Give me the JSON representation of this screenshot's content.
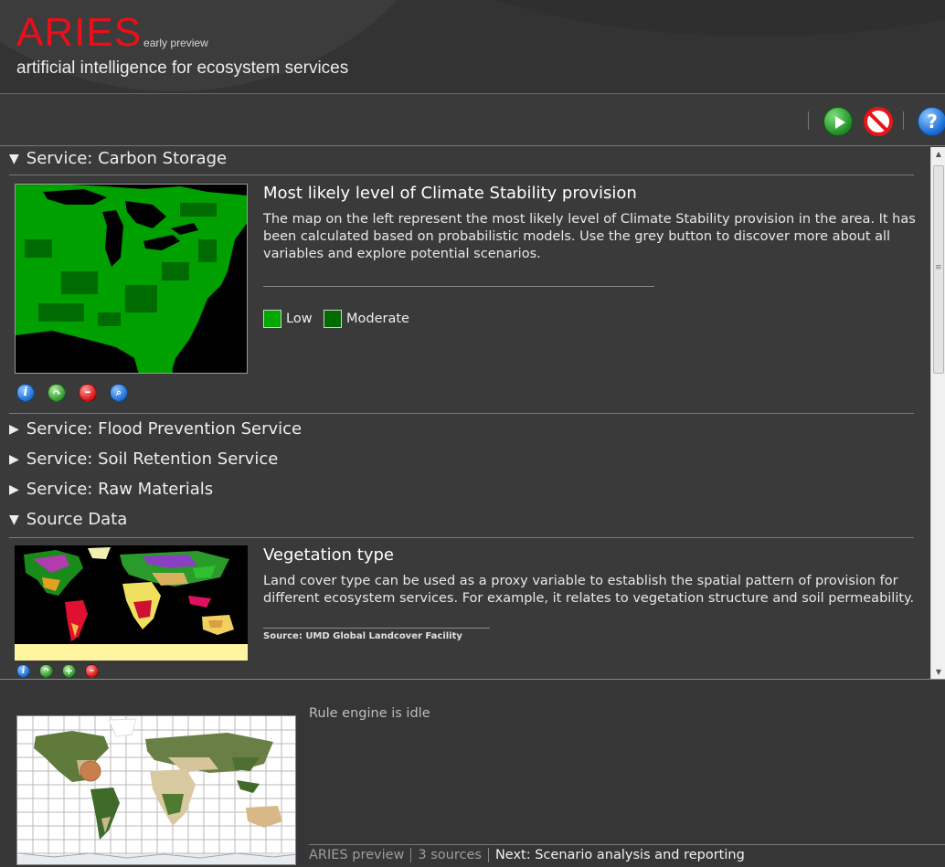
{
  "header": {
    "brand": "ARIES",
    "brand_sub": "early preview",
    "tagline": "artificial intelligence for ecosystem services"
  },
  "toolbar": {
    "run_icon": "play-icon",
    "stop_icon": "stop-icon",
    "help_icon": "help-icon",
    "help_glyph": "?"
  },
  "sections": {
    "carbon": {
      "label": "Service: Carbon Storage",
      "expanded": true
    },
    "flood": {
      "label": "Service: Flood Prevention Service",
      "expanded": false
    },
    "soil": {
      "label": "Service: Soil Retention Service",
      "expanded": false
    },
    "raw": {
      "label": "Service: Raw Materials",
      "expanded": false
    },
    "source": {
      "label": "Source Data",
      "expanded": true
    }
  },
  "carbon_card": {
    "title": "Most likely level of Climate Stability provision",
    "description": "The map on the left represent the most likely level of Climate Stability provision in the area. It has been calculated based on probabilistic models. Use the grey button to discover more about all variables and explore potential scenarios.",
    "legend": [
      {
        "label": "Low",
        "color": "#00a800"
      },
      {
        "label": "Moderate",
        "color": "#006b00"
      }
    ],
    "actions": [
      "info-icon",
      "share-icon",
      "remove-icon",
      "zoom-icon"
    ]
  },
  "vegetation_card": {
    "title": "Vegetation type",
    "description": "Land cover type can be used as a proxy variable to establish the spatial pattern of provision for different ecosystem services. For example, it relates to vegetation structure and soil permeability.",
    "source": "Source: UMD Global Landcover Facility",
    "actions": [
      "info-icon",
      "share-icon",
      "add-icon",
      "remove-icon"
    ]
  },
  "status": {
    "engine": "Rule engine is idle"
  },
  "footer": {
    "app": "ARIES preview",
    "sources": "3 sources",
    "next": "Next: Scenario analysis and reporting"
  },
  "colors": {
    "brand_red": "#e8101a",
    "background": "#3a3a3a"
  }
}
